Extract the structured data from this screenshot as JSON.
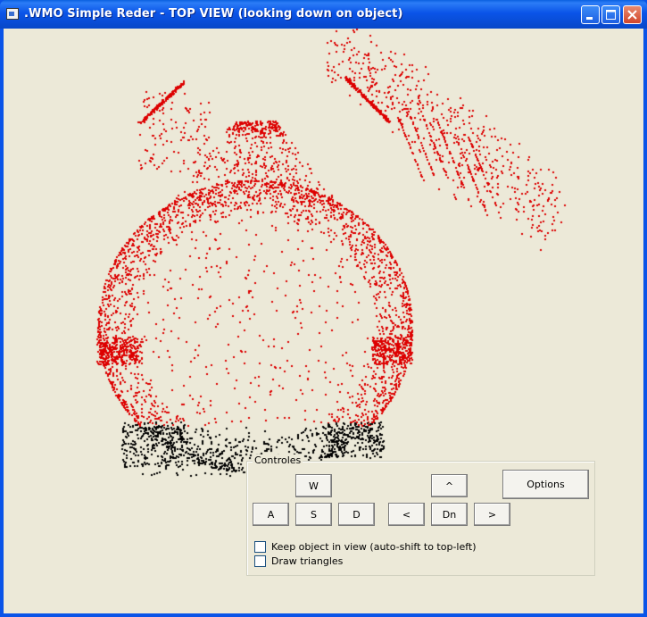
{
  "window": {
    "title": ".WMO Simple Reder - TOP VIEW (looking down on object)",
    "icon": "app-window-icon"
  },
  "titlebar_buttons": [
    {
      "name": "minimize",
      "icon": "minimize-icon"
    },
    {
      "name": "maximize",
      "icon": "maximize-icon"
    },
    {
      "name": "close",
      "icon": "close-icon"
    }
  ],
  "render": {
    "point_color_main": "#dd0000",
    "point_color_near": "#000000",
    "background": "#ece9d8"
  },
  "controls": {
    "legend": "Controles",
    "buttons": {
      "w": "W",
      "a": "A",
      "s": "S",
      "d": "D",
      "up": "^",
      "left": "<",
      "down": "Dn",
      "right": ">",
      "options": "Options"
    },
    "checkboxes": [
      {
        "label": "Keep object in view (auto-shift to top-left)",
        "checked": false
      },
      {
        "label": "Draw triangles",
        "checked": false
      }
    ]
  },
  "colors": {
    "title_bar": "#0a54e8",
    "window_bg": "#ece9d8",
    "close_button": "#d1452a"
  }
}
